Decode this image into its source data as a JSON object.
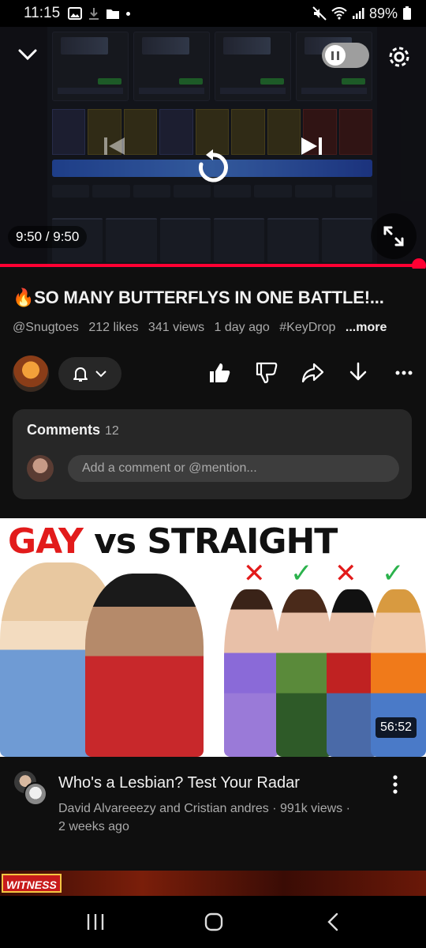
{
  "status_bar": {
    "time": "11:15",
    "battery": "89%"
  },
  "player": {
    "timecode": "9:50 / 9:50",
    "progress": 1.0,
    "autoplay_enabled": true
  },
  "video": {
    "title": "🔥SO MANY BUTTERFLYS IN ONE BATTLE!...",
    "channel": "@Snugtoes",
    "likes": "212 likes",
    "views": "341 views",
    "age": "1 day ago",
    "hashtag": "#KeyDrop",
    "more": "...more"
  },
  "comments": {
    "label": "Comments",
    "count": "12",
    "placeholder": "Add a comment or @mention..."
  },
  "next_video": {
    "thumbnail_text": {
      "word1": "GAY",
      "word2": "vs STRAIGHT"
    },
    "duration": "56:52",
    "title": "Who's a Lesbian? Test Your Radar",
    "meta_line": "David Alvareeezy and Cristian andres · 991k views ·",
    "age": "2 weeks ago"
  },
  "following_video": {
    "badge": "WITNESS"
  },
  "colors": {
    "accent_red": "#ff0033",
    "background": "#0f0f0f",
    "surface": "#272727"
  },
  "icons": [
    "collapse-chevron-icon",
    "pause-icon",
    "settings-gear-icon",
    "previous-icon",
    "replay-icon",
    "next-icon",
    "fullscreen-icon",
    "bell-icon",
    "like-icon",
    "dislike-icon",
    "share-icon",
    "download-icon",
    "more-icon"
  ]
}
